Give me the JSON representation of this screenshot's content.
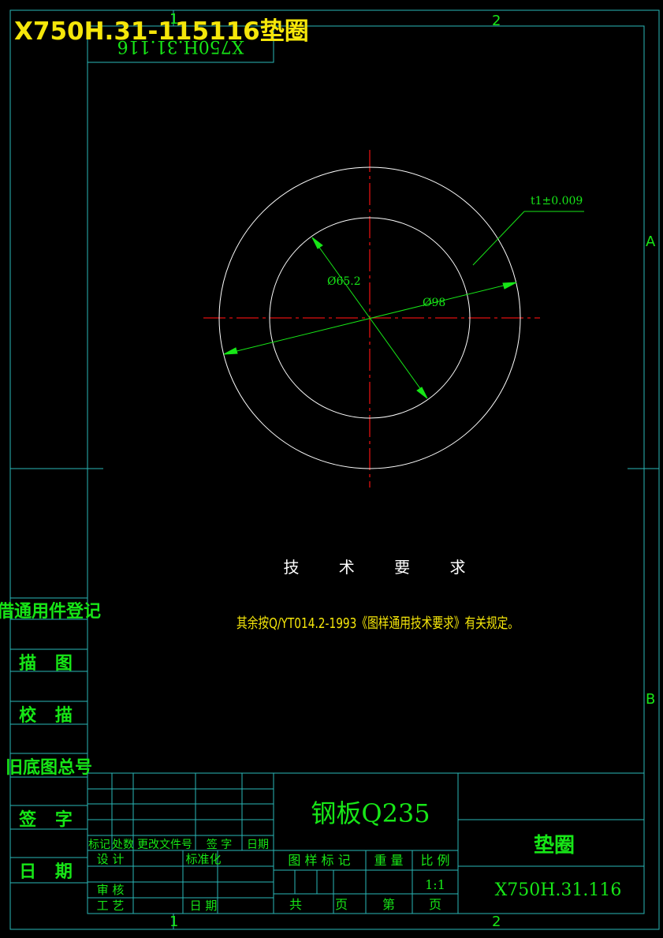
{
  "header_title": "X750H.31-115116垫圈",
  "mirrored_code": "X750H.31.116",
  "zone_markers": {
    "top_1": "1",
    "top_2": "2",
    "bottom_1": "1",
    "bottom_2": "2",
    "side_a": "A",
    "side_b": "B"
  },
  "dimensions": {
    "thickness": "t1±0.009",
    "inner_dia": "Ø65.2",
    "outer_dia": "Ø98"
  },
  "tech_req": {
    "title": "技 术 要 求",
    "note": "其余按Q/YT014.2-1993《图样通用技术要求》有关规定。"
  },
  "side_panel": [
    "借通用件登记",
    "描 图",
    "校 描",
    "旧底图总号",
    "签 字",
    "日 期"
  ],
  "title_block": {
    "material": "钢板Q235",
    "part_name": "垫圈",
    "drawing_no": "X750H.31.116",
    "rev_headers": [
      "标记",
      "处数",
      "更改文件号",
      "签 字",
      "日期"
    ],
    "design": "设 计",
    "standardize": "标准化",
    "review": "审 核",
    "process": "工 艺",
    "date": "日 期",
    "mark_hdr": "图 样 标 记",
    "weight_hdr": "重 量",
    "scale_hdr": "比 例",
    "scale": "1:1",
    "total": "共",
    "sheet_unit": "页",
    "sheet_no": "第",
    "sheet_unit2": "页"
  },
  "colors": {
    "border": "#2ab7b7",
    "text": "#17e617",
    "title": "#f5e60a",
    "centerline": "#e01010",
    "geometry": "#ffffff"
  }
}
